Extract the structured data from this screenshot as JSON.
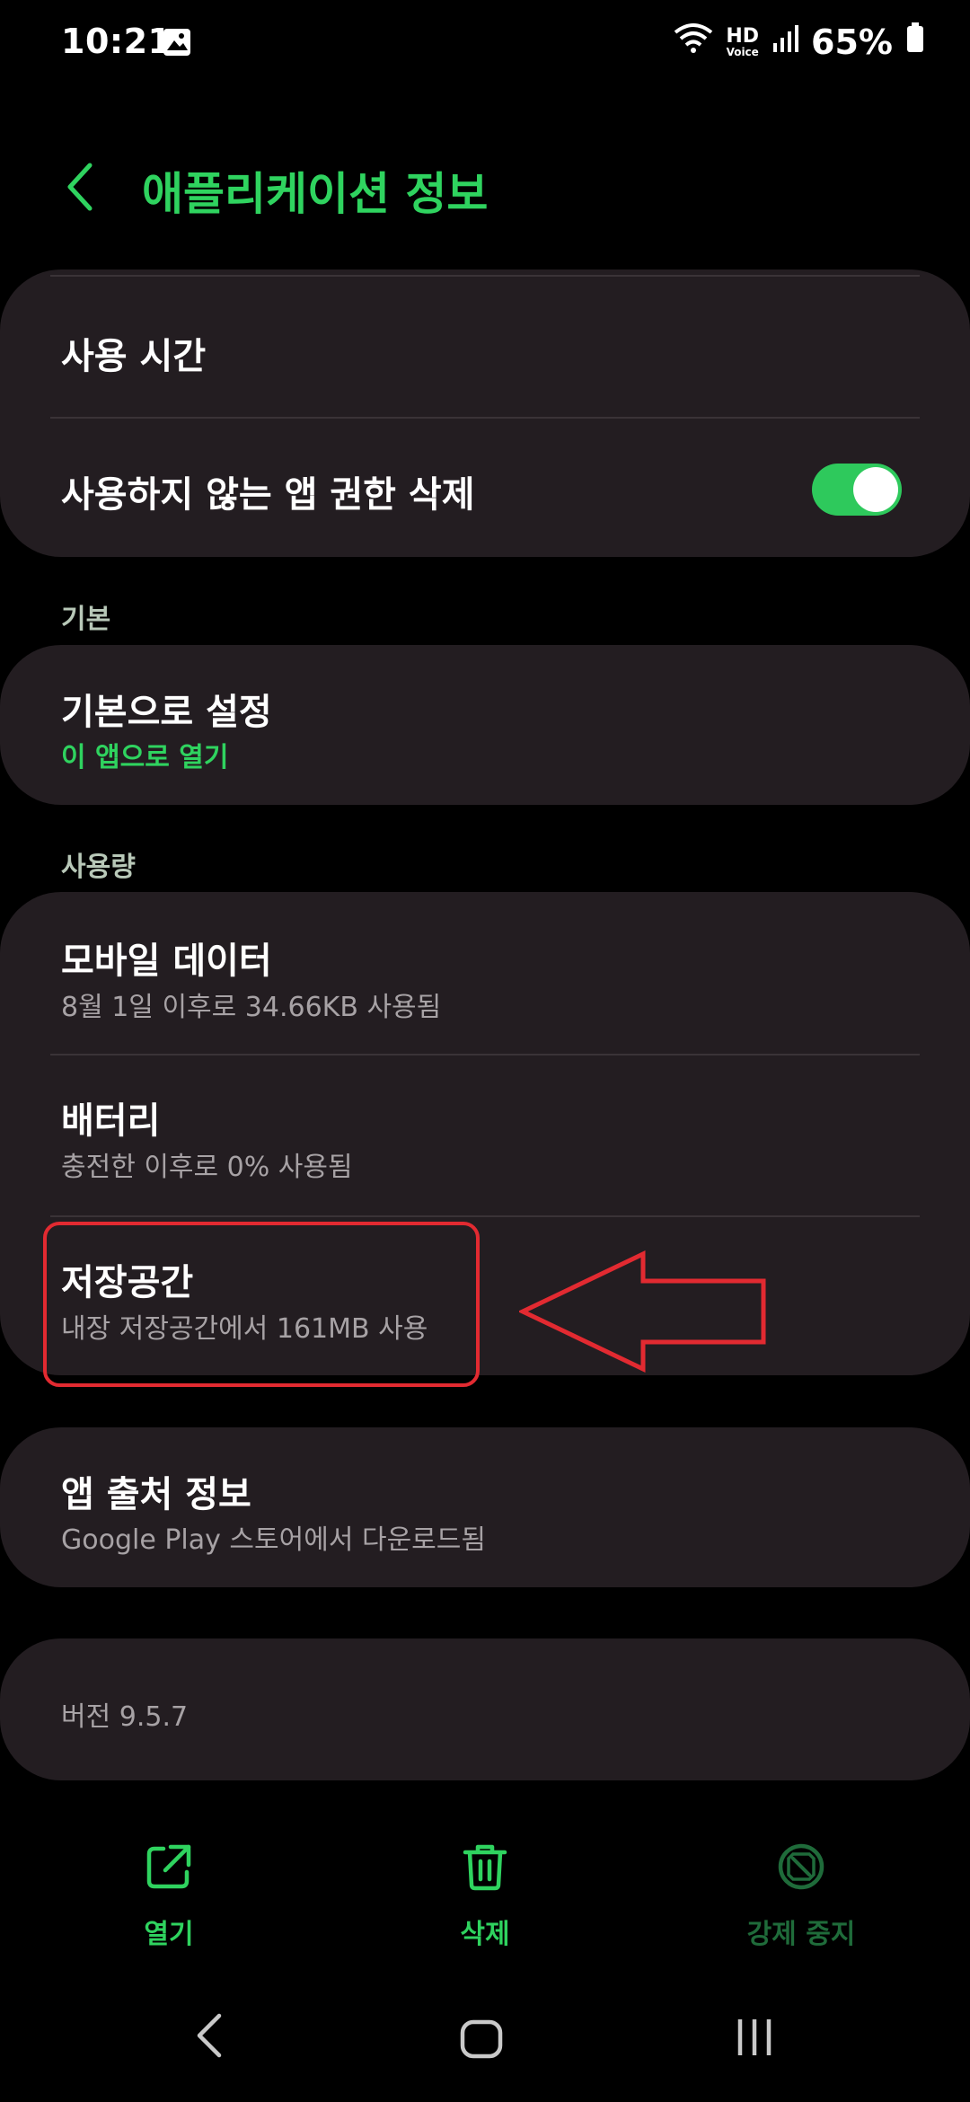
{
  "status_bar": {
    "time": "10:21",
    "battery_percent": "65%",
    "icons": [
      "gallery-notification-icon",
      "wifi-icon",
      "hd-voice-icon",
      "signal-icon",
      "battery-icon"
    ],
    "hd_label": "HD",
    "voice_label": "Voice"
  },
  "header": {
    "title": "애플리케이션 정보"
  },
  "top_card": {
    "items": [
      {
        "label": "사용 시간"
      },
      {
        "label": "사용하지 않는 앱 권한 삭제",
        "toggle_on": true
      }
    ]
  },
  "sections": {
    "default_label": "기본",
    "usage_label": "사용량"
  },
  "default_card": {
    "title": "기본으로 설정",
    "subtitle": "이 앱으로 열기"
  },
  "usage_card": {
    "items": [
      {
        "title": "모바일 데이터",
        "subtitle": "8월 1일 이후로 34.66KB 사용됨"
      },
      {
        "title": "배터리",
        "subtitle": "충전한 이후로 0% 사용됨"
      },
      {
        "title": "저장공간",
        "subtitle": "내장 저장공간에서 161MB 사용"
      }
    ]
  },
  "source_card": {
    "title": "앱 출처 정보",
    "subtitle": "Google Play 스토어에서 다운로드됨"
  },
  "version_card": {
    "text": "버전 9.5.7"
  },
  "bottom_actions": [
    {
      "label": "열기",
      "icon": "open-external-icon",
      "enabled": true
    },
    {
      "label": "삭제",
      "icon": "trash-icon",
      "enabled": true
    },
    {
      "label": "강제 중지",
      "icon": "force-stop-icon",
      "enabled": false
    }
  ],
  "colors": {
    "accent": "#2fd35f",
    "disabled_accent": "#1f6b3a",
    "card_bg": "#231d21",
    "annotation": "#e22a31"
  }
}
